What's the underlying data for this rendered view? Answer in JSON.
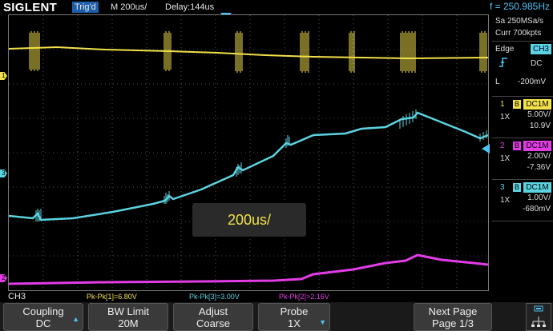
{
  "top": {
    "brand": "SIGLENT",
    "trigger_status": "Trig'd",
    "timebase": "M 200us/",
    "delay": "Delay:144us",
    "frequency": "f = 250.985Hz"
  },
  "acquisition": {
    "sample_rate": "Sa 250MSa/s",
    "memory": "Curr 700kpts"
  },
  "trigger": {
    "type": "Edge",
    "source": "CH3",
    "coupling": "DC",
    "level_label": "L",
    "level": "-200mV"
  },
  "channels": [
    {
      "num": "1",
      "coupling": "DC1M",
      "probe": "1X",
      "scale": "5.00V/",
      "offset": "10.9V",
      "color": "#f2e14a"
    },
    {
      "num": "2",
      "coupling": "DC1M",
      "probe": "1X",
      "scale": "2.00V/",
      "offset": "-7.36V",
      "color": "#e23ce6"
    },
    {
      "num": "3",
      "coupling": "DC1M",
      "probe": "1X",
      "scale": "1.00V/",
      "offset": "-680mV",
      "color": "#5bd3e0"
    }
  ],
  "popup": {
    "text": "200us/"
  },
  "measurements": {
    "channel_label": "CH3",
    "items": [
      {
        "text": "Pk-Pk[1]=6.80V",
        "color": "#f2e14a"
      },
      {
        "text": "Pk-Pk[3]=3.00V",
        "color": "#5bd3e0"
      },
      {
        "text": "Pk-Pk[2]>2.16V",
        "color": "#e23ce6"
      }
    ]
  },
  "menu": {
    "coupling": {
      "line1": "Coupling",
      "line2": "DC"
    },
    "bw_limit": {
      "line1": "BW Limit",
      "line2": "20M"
    },
    "adjust": {
      "line1": "Adjust",
      "line2": "Coarse"
    },
    "probe": {
      "line1": "Probe",
      "line2": "1X"
    },
    "next_page": {
      "line1": "Next Page",
      "line2": "Page 1/3"
    }
  },
  "markers": {
    "ch1": "1",
    "ch2": "2",
    "ch3": "3"
  },
  "colors": {
    "ch1": "#f2e14a",
    "ch2": "#e23ce6",
    "ch3": "#5bd3e0",
    "accent": "#4fc3f7",
    "trig_badge": "#1d5fa8"
  }
}
